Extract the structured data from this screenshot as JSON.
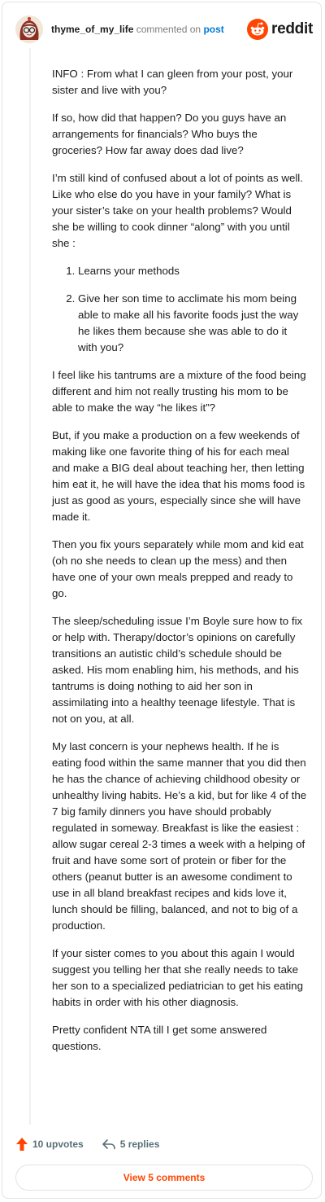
{
  "header": {
    "username": "thyme_of_my_life",
    "action_text": "commented on",
    "post_link": "post",
    "brand_word": "reddit"
  },
  "comment": {
    "paragraphs_before_list": [
      "INFO : From what I can gleen from your post, your sister and live with you?",
      "If so, how did that happen? Do you guys have an arrangements for financials? Who buys the groceries? How far away does dad live?",
      "I’m still kind of confused about a lot of points as well. Like who else do you have in your family? What is your sister’s take on your health problems? Would she be willing to cook dinner “along” with you until she :"
    ],
    "list_items": [
      "Learns your methods",
      "Give her son time to acclimate his mom being able to make all his favorite foods just the way he likes them because she was able to do it with you?"
    ],
    "paragraphs_after_list": [
      "I feel like his tantrums are a mixture of the food being different and him not really trusting his mom to be able to make the way “he likes it”?",
      "But, if you make a production on a few weekends of making like one favorite thing of his for each meal and make a BIG deal about teaching her, then letting him eat it, he will have the idea that his moms food is just as good as yours, especially since she will have made it.",
      "Then you fix yours separately while mom and kid eat (oh no she needs to clean up the mess) and then have one of your own meals prepped and ready to go.",
      "The sleep/scheduling issue I’m Boyle sure how to fix or help with. Therapy/doctor’s opinions on carefully transitions an autistic child’s schedule should be asked. His mom enabling him, his methods, and his tantrums is doing nothing to aid her son in assimilating into a healthy teenage lifestyle. That is not on you, at all.",
      "My last concern is your nephews health. If he is eating food within the same manner that you did then he has the chance of achieving childhood obesity or unhealthy living habits. He’s a kid, but for like 4 of the 7 big family dinners you have should probably regulated in someway. Breakfast is like the easiest : allow sugar cereal 2-3 times a week with a helping of fruit and have some sort of protein or fiber for the others (peanut butter is an awesome condiment to use in all bland breakfast recipes and kids love it, lunch should be filling, balanced, and not to big of a production.",
      "If your sister comes to you about this again I would suggest you telling her that she really needs to take her son to a specialized pediatrician to get his eating habits in order with his other diagnosis.",
      "Pretty confident NTA till I get some answered questions."
    ]
  },
  "actions": {
    "upvotes_label": "10 upvotes",
    "replies_label": "5 replies",
    "upvote_icon": "upvote-arrow-icon",
    "reply_icon": "reply-arrow-icon"
  },
  "footer": {
    "view_comments_label": "View 5 comments"
  },
  "colors": {
    "accent": "#ff4500",
    "link": "#0079d3",
    "muted": "#576f76",
    "text": "#1c1c1c"
  }
}
